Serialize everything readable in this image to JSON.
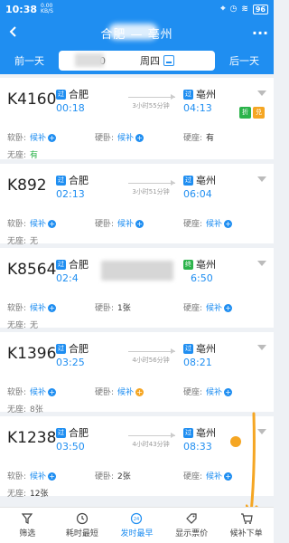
{
  "status_bar": {
    "time": "10:38",
    "speed_value": "0.00",
    "speed_unit": "KB/S",
    "battery": "96"
  },
  "header": {
    "title": "合肥 — 亳州",
    "back_icon": "back-arrow-icon",
    "more_label": "···"
  },
  "date_bar": {
    "prev_label": "前一天",
    "next_label": "后一天",
    "date_prefix": "0",
    "weekday": "周四"
  },
  "trains": [
    {
      "number": "K4160",
      "from_badge": "过",
      "from": "合肥",
      "dep_time": "00:18",
      "duration": "3小时55分钟",
      "to_badge": "过",
      "to": "亳州",
      "arr_time": "04:13",
      "badges": [
        "折",
        "兑"
      ],
      "seat1_label": "软卧:",
      "seat1_val": "候补",
      "seat2_label": "硬卧:",
      "seat2_val": "候补",
      "seat3_label": "硬座:",
      "seat3_val": "有",
      "seat4_label": "无座:",
      "seat4_val": "有"
    },
    {
      "number": "K892",
      "from_badge": "过",
      "from": "合肥",
      "dep_time": "02:13",
      "duration": "3小时51分钟",
      "to_badge": "过",
      "to": "亳州",
      "arr_time": "06:04",
      "seat1_label": "软卧:",
      "seat1_val": "候补",
      "seat2_label": "硬卧:",
      "seat2_val": "候补",
      "seat3_label": "硬座:",
      "seat3_val": "候补",
      "seat4_label": "无座:",
      "seat4_val": "无"
    },
    {
      "number": "K8564",
      "from_badge": "过",
      "from": "合肥",
      "dep_time": "02:4",
      "duration": "",
      "to_badge": "终",
      "to": "亳州",
      "arr_time": "6:50",
      "seat1_label": "软卧:",
      "seat1_val": "候补",
      "seat2_label": "硬卧:",
      "seat2_val": "1张",
      "seat3_label": "硬座:",
      "seat3_val": "候补",
      "seat4_label": "无座:",
      "seat4_val": "无"
    },
    {
      "number": "K1396",
      "from_badge": "过",
      "from": "合肥",
      "dep_time": "03:25",
      "duration": "4小时56分钟",
      "to_badge": "过",
      "to": "亳州",
      "arr_time": "08:21",
      "seat1_label": "软卧:",
      "seat1_val": "候补",
      "seat2_label": "硬卧:",
      "seat2_val": "候补",
      "seat3_label": "硬座:",
      "seat3_val": "候补",
      "seat4_label": "无座:",
      "seat4_val": "8张"
    },
    {
      "number": "K1238",
      "from_badge": "过",
      "from": "合肥",
      "dep_time": "03:50",
      "duration": "4小时43分钟",
      "to_badge": "过",
      "to": "亳州",
      "arr_time": "08:33",
      "seat1_label": "软卧:",
      "seat1_val": "候补",
      "seat2_label": "硬卧:",
      "seat2_val": "2张",
      "seat3_label": "硬座:",
      "seat3_val": "候补",
      "seat4_label": "无座:",
      "seat4_val": "12张"
    }
  ],
  "bottom_bar": {
    "filter_label": "筛选",
    "shortest_label": "耗时最短",
    "earliest_label": "发时最早",
    "price_label": "显示票价",
    "waitlist_label": "候补下单"
  },
  "colors": {
    "primary": "#1f8ef1",
    "accent_orange": "#f5a623",
    "green": "#2bb34a"
  }
}
